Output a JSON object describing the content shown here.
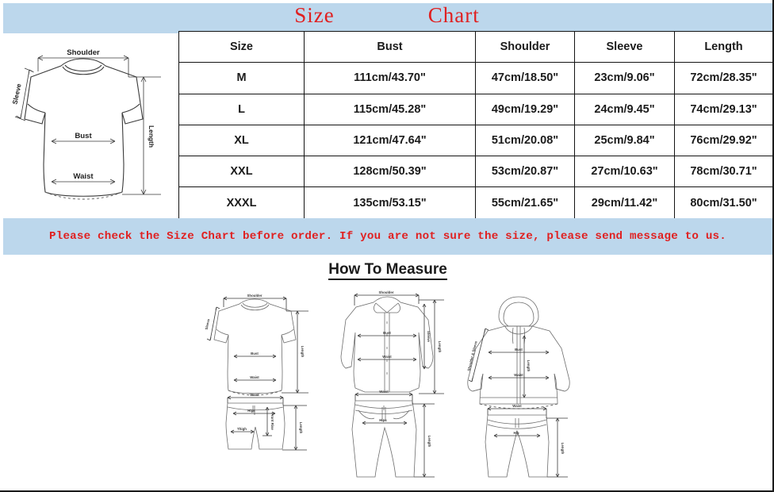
{
  "title": {
    "word1": "Size",
    "word2": "Chart",
    "color": "#e02020"
  },
  "theme": {
    "band_blue": "#bcd7ec",
    "accent_red": "#e02020",
    "ink": "#1b1b1b"
  },
  "table": {
    "columns": [
      "Size",
      "Bust",
      "Shoulder",
      "Sleeve",
      "Length"
    ],
    "rows": [
      {
        "size": "M",
        "bust": "111cm/43.70\"",
        "shoulder": "47cm/18.50\"",
        "sleeve": "23cm/9.06\"",
        "length": "72cm/28.35\""
      },
      {
        "size": "L",
        "bust": "115cm/45.28\"",
        "shoulder": "49cm/19.29\"",
        "sleeve": "24cm/9.45\"",
        "length": "74cm/29.13\""
      },
      {
        "size": "XL",
        "bust": "121cm/47.64\"",
        "shoulder": "51cm/20.08\"",
        "sleeve": "25cm/9.84\"",
        "length": "76cm/29.92\""
      },
      {
        "size": "XXL",
        "bust": "128cm/50.39\"",
        "shoulder": "53cm/20.87\"",
        "sleeve": "27cm/10.63\"",
        "length": "78cm/30.71\""
      },
      {
        "size": "XXXL",
        "bust": "135cm/53.15\"",
        "shoulder": "55cm/21.65\"",
        "sleeve": "29cm/11.42\"",
        "length": "80cm/31.50\""
      }
    ]
  },
  "notice": {
    "text": "Please check the Size Chart before order. If you are not sure the size, please send message to us."
  },
  "tshirt_diagram": {
    "labels": {
      "shoulder": "Shoulder",
      "sleeve": "Sleeve",
      "bust": "Bust",
      "waist": "Waist",
      "length": "Length"
    }
  },
  "how_to_measure": {
    "title": "How To Measure",
    "figures": [
      {
        "name": "tshirt-and-shorts",
        "top_garment": "t-shirt",
        "bottom_garment": "shorts",
        "labels": [
          "Shoulder",
          "Sleeve",
          "Bust",
          "Length",
          "Waist",
          "Hips",
          "Front Rise",
          "Thigh",
          "Length"
        ]
      },
      {
        "name": "shirt-and-pants",
        "top_garment": "long-sleeve-shirt",
        "bottom_garment": "pants",
        "labels": [
          "Shoulder",
          "Bust",
          "Waist",
          "Sleeve",
          "Length",
          "Waist",
          "Hips",
          "Length"
        ]
      },
      {
        "name": "hoodie-and-joggers",
        "top_garment": "zip-hoodie",
        "bottom_garment": "joggers",
        "labels": [
          "Shoulder & Sleeve",
          "Bust",
          "Length",
          "Waist",
          "Waist",
          "Hip",
          "Length"
        ]
      }
    ]
  }
}
